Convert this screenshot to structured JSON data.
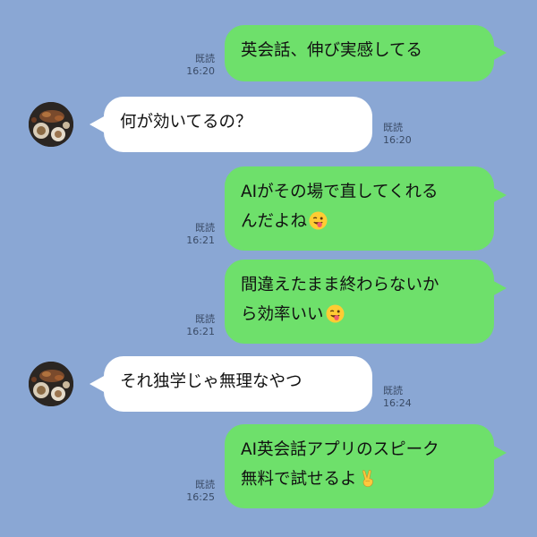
{
  "messages": [
    {
      "side": "me",
      "text": "英会話、伸び実感してる",
      "read": "既読",
      "time": "16:20"
    },
    {
      "side": "them",
      "text": "何が効いてるの？",
      "read": "既読",
      "time": "16:20"
    },
    {
      "side": "me",
      "line1": "AIがその場で直してくれる",
      "line2": "んだよね",
      "emoji": "winking-face-tongue",
      "read": "既読",
      "time": "16:21"
    },
    {
      "side": "me",
      "line1": "間違えたまま終わらないか",
      "line2": "ら効率いい",
      "emoji": "winking-face-tongue",
      "read": "既読",
      "time": "16:21"
    },
    {
      "side": "them",
      "text": "それ独学じゃ無理なやつ",
      "read": "既読",
      "time": "16:24"
    },
    {
      "side": "me",
      "line1": "AI英会話アプリのスピーク",
      "line2": "無料で試せるよ",
      "emoji": "victory-hand",
      "read": "既読",
      "time": "16:25"
    }
  ],
  "colors": {
    "background": "#8aa7d4",
    "my_bubble": "#6ee06b",
    "their_bubble": "#ffffff"
  }
}
